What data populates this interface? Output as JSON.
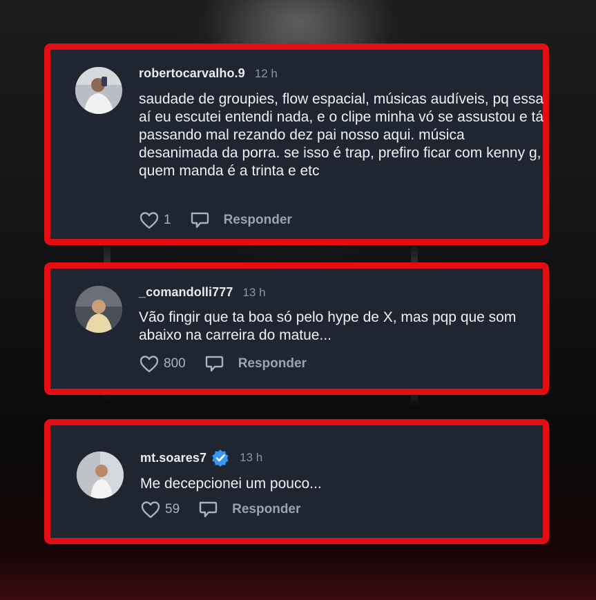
{
  "comments": [
    {
      "username": "robertocarvalho.9",
      "time": "12 h",
      "verified": false,
      "text": "saudade de groupies, flow espacial, músicas audíveis, pq essa aí eu escutei entendi nada, e o clipe minha vó se assustou e tá passando mal rezando dez pai nosso aqui. música desanimada da porra. se isso é trap, prefiro ficar com kenny g, quem manda é a trinta e etc",
      "likes": "1",
      "reply_label": "Responder"
    },
    {
      "username": "_comandolli777",
      "time": "13 h",
      "verified": false,
      "text": "Vão fingir que ta boa só pelo hype de X, mas pqp que som abaixo na carreira do matue...",
      "likes": "800",
      "reply_label": "Responder"
    },
    {
      "username": "mt.soares7",
      "time": "13 h",
      "verified": true,
      "text": "Me decepcionei um pouco...",
      "likes": "59",
      "reply_label": "Responder"
    }
  ],
  "colors": {
    "highlight_border": "#e40d13",
    "card_background": "#202631",
    "verified_badge": "#3897f0"
  },
  "icons": {
    "like": "heart-icon",
    "comment": "speech-bubble-icon",
    "verified": "verified-badge-icon"
  }
}
